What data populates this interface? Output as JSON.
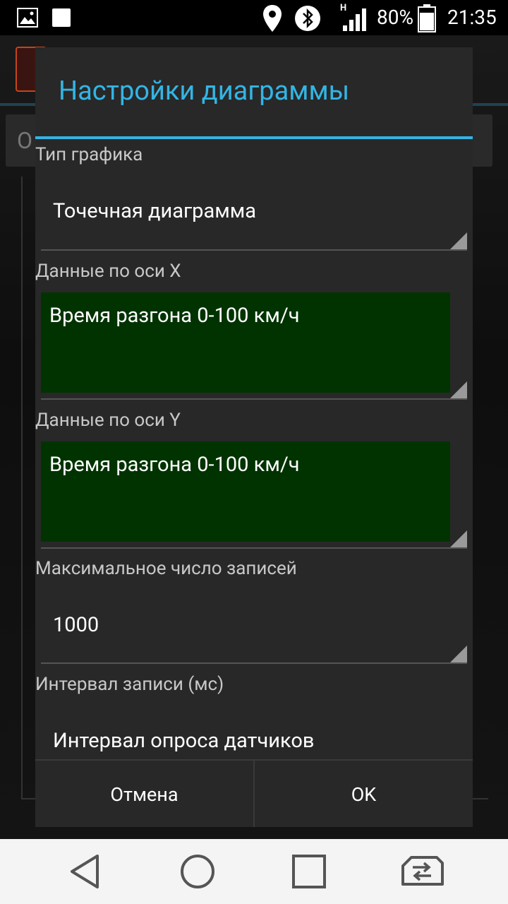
{
  "status_bar": {
    "network_type": "H",
    "battery_percent": "80%",
    "time": "21:35",
    "icons": [
      "image-icon",
      "notification-square-icon",
      "location-icon",
      "bluetooth-icon",
      "signal-icon",
      "battery-icon"
    ]
  },
  "background": {
    "field_text": "О"
  },
  "dialog": {
    "title": "Настройки диаграммы",
    "chart_type": {
      "label": "Тип графика",
      "value": "Точечная диаграмма"
    },
    "x_axis": {
      "label": "Данные по оси X",
      "value": "Время разгона 0-100 км/ч"
    },
    "y_axis": {
      "label": "Данные по оси Y",
      "value": "Время разгона 0-100 км/ч"
    },
    "max_records": {
      "label": "Максимальное число записей",
      "value": "1000"
    },
    "interval": {
      "label": "Интервал записи (мс)",
      "value": "Интервал опроса датчиков"
    },
    "cancel_label": "Отмена",
    "ok_label": "OK"
  },
  "colors": {
    "accent": "#33b5e5",
    "dialog_bg": "#282828",
    "selected_bg": "#013300"
  },
  "nav_bar": {
    "icons": [
      "back-icon",
      "home-icon",
      "recents-icon",
      "switch-sim-icon"
    ]
  }
}
